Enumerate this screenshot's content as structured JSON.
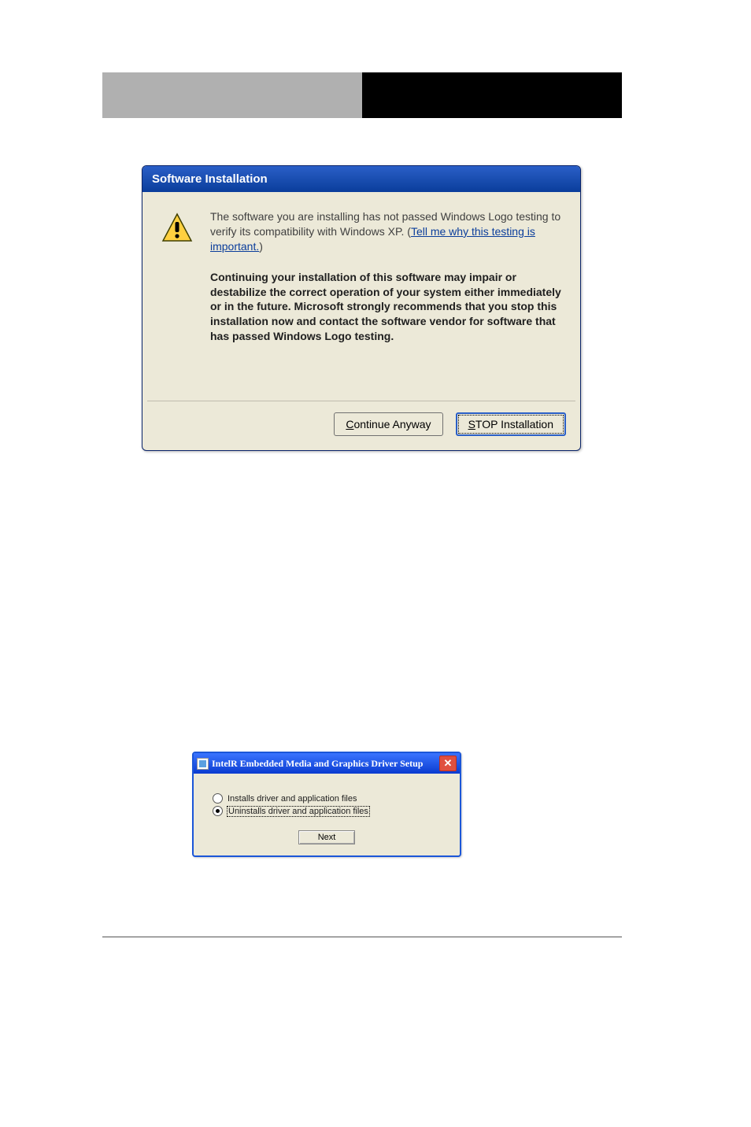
{
  "dialog1": {
    "title": "Software Installation",
    "intro_text": "The software you are installing has not passed Windows Logo testing to verify its compatibility with Windows XP. (",
    "link_text": "Tell me why this testing is important.",
    "intro_close": ")",
    "bold_warning": "Continuing your installation of this software may impair or destabilize the correct operation of your system either immediately or in the future. Microsoft strongly recommends that you stop this installation now and contact the software vendor for software that has passed Windows Logo testing.",
    "buttons": {
      "continue_pre": "C",
      "continue_post": "ontinue Anyway",
      "stop_pre": "S",
      "stop_post": "TOP Installation"
    }
  },
  "dialog2": {
    "title": "IntelR Embedded Media and Graphics Driver Setup",
    "option_install": "Installs driver and application files",
    "option_uninstall": "Uninstalls driver and application files",
    "next_label": "Next"
  }
}
